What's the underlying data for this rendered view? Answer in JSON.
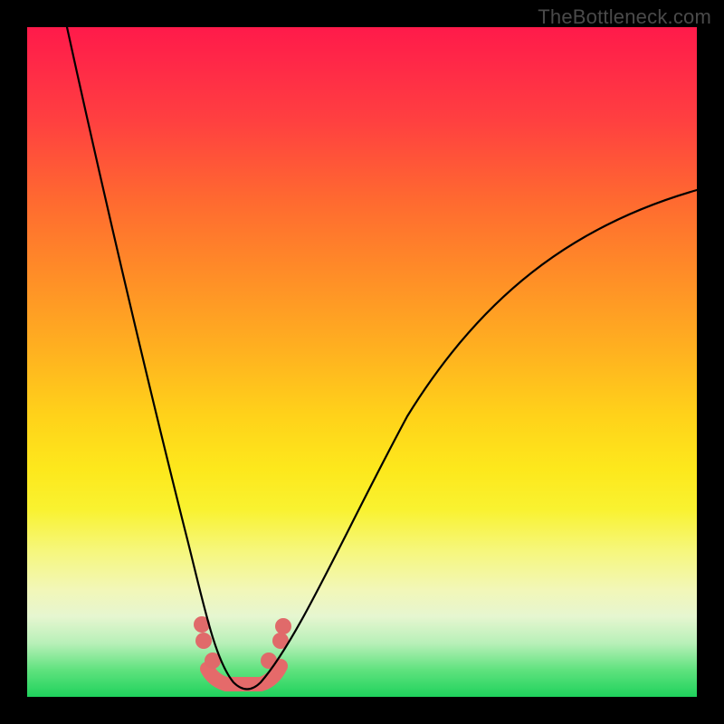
{
  "watermark": {
    "text": "TheBottleneck.com"
  },
  "colors": {
    "curve": "#000000",
    "band": "#e56a6a",
    "dots": "#e06a6a",
    "frame_bg_top": "#ff1a4a",
    "frame_bg_bottom": "#1fd25c",
    "page_bg": "#000000"
  },
  "chart_data": {
    "type": "line",
    "title": "",
    "xlabel": "",
    "ylabel": "",
    "xlim": [
      0,
      100
    ],
    "ylim": [
      0,
      100
    ],
    "grid": false,
    "legend": false,
    "notes": "Bottleneck-style V curve on a vertical rainbow gradient. No axes or tick labels are shown; x/y are normalized 0–100. y≈bottleneck% (0=green bottom, 100=red top). Minimum (best match) around x≈31 with y≈2.",
    "series": [
      {
        "name": "bottleneck-curve",
        "x": [
          5,
          10,
          15,
          20,
          24,
          27,
          29,
          31,
          33,
          35,
          38,
          42,
          48,
          56,
          65,
          75,
          85,
          95,
          100
        ],
        "y": [
          100,
          80,
          60,
          40,
          24,
          12,
          5,
          2,
          3,
          5,
          10,
          18,
          30,
          43,
          55,
          64,
          70,
          74,
          76
        ]
      }
    ],
    "optimal_band": {
      "x_start": 27,
      "x_end": 36,
      "y": 2
    },
    "marker_dots": [
      {
        "x": 25.5,
        "y": 10
      },
      {
        "x": 25.8,
        "y": 7
      },
      {
        "x": 27.5,
        "y": 4
      },
      {
        "x": 35.0,
        "y": 4
      },
      {
        "x": 36.8,
        "y": 7
      },
      {
        "x": 37.2,
        "y": 10
      }
    ]
  }
}
